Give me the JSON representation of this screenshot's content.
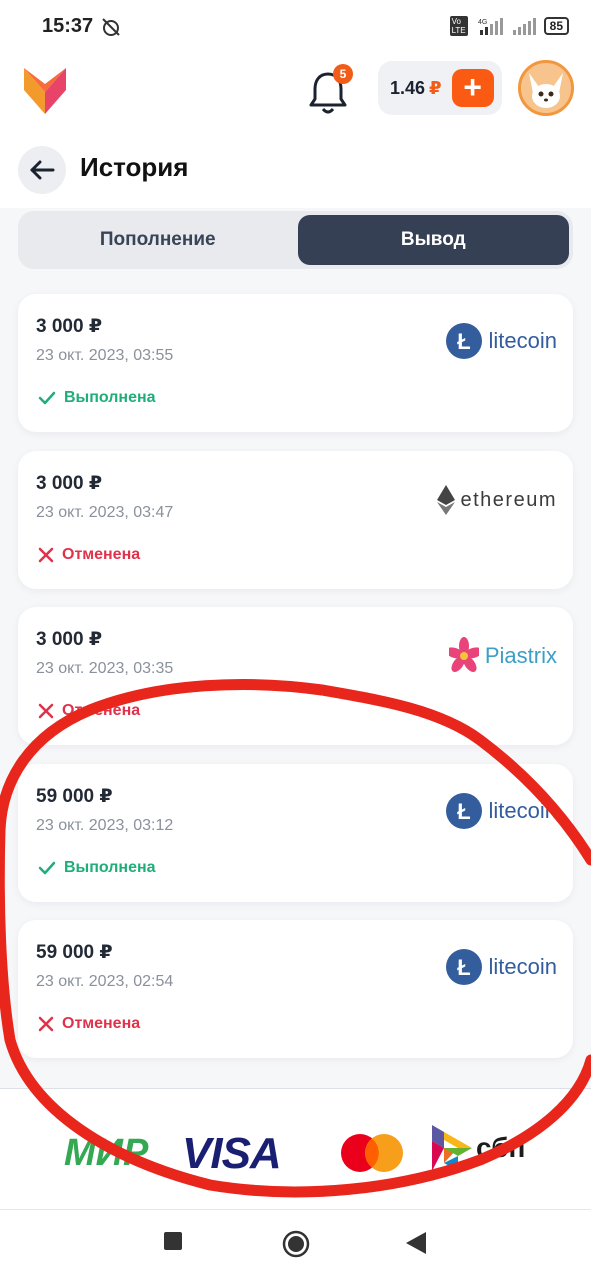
{
  "status_bar": {
    "time": "15:37",
    "battery": "85",
    "network": "4G",
    "volte": "Vo LTE"
  },
  "header": {
    "notifications_count": "5",
    "balance": "1.46",
    "balance_currency": "₽",
    "topup_label": "+"
  },
  "page": {
    "title": "История"
  },
  "tabs": [
    {
      "label": "Пополнение",
      "active": false
    },
    {
      "label": "Вывод",
      "active": true
    }
  ],
  "transactions": [
    {
      "amount": "3 000 ₽",
      "date": "23 окт. 2023, 03:55",
      "status": "Выполнена",
      "status_type": "success",
      "method": "litecoin"
    },
    {
      "amount": "3 000 ₽",
      "date": "23 окт. 2023, 03:47",
      "status": "Отменена",
      "status_type": "cancelled",
      "method": "ethereum"
    },
    {
      "amount": "3 000 ₽",
      "date": "23 окт. 2023, 03:35",
      "status": "Отменена",
      "status_type": "cancelled",
      "method": "Piastrix"
    },
    {
      "amount": "59 000 ₽",
      "date": "23 окт. 2023, 03:12",
      "status": "Выполнена",
      "status_type": "success",
      "method": "litecoin"
    },
    {
      "amount": "59 000 ₽",
      "date": "23 окт. 2023, 02:54",
      "status": "Отменена",
      "status_type": "cancelled",
      "method": "litecoin"
    }
  ],
  "payment_logos": {
    "mir": "МИР",
    "visa": "VISA",
    "sbp": "сбп"
  },
  "colors": {
    "accent": "#fa5a12",
    "tab_active": "#364054",
    "success": "#1fae7a",
    "cancelled": "#e0324b",
    "scribble": "#e8261c"
  }
}
